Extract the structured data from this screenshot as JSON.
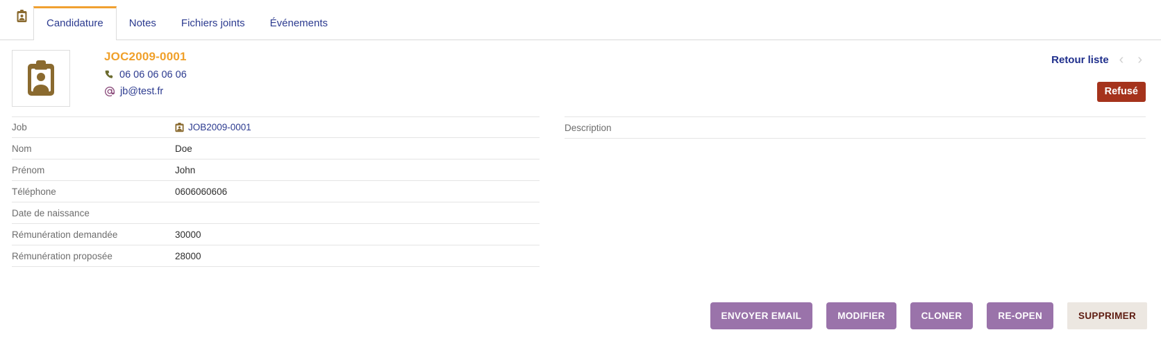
{
  "tabs": {
    "icon": "id-badge-icon",
    "items": [
      {
        "label": "Candidature",
        "active": true
      },
      {
        "label": "Notes",
        "active": false
      },
      {
        "label": "Fichiers joints",
        "active": false
      },
      {
        "label": "Événements",
        "active": false
      }
    ]
  },
  "header": {
    "avatar_icon": "id-badge-icon",
    "record_title": "JOC2009-0001",
    "phone": "06 06 06 06 06",
    "phone_icon": "phone-icon",
    "email": "jb@test.fr",
    "email_icon": "at-sign-icon",
    "back_label": "Retour liste",
    "prev_icon": "chevron-left-icon",
    "next_icon": "chevron-right-icon",
    "status": "Refusé",
    "status_color": "#a5331c",
    "title_color": "#f0a02a"
  },
  "fields": [
    {
      "label": "Job",
      "value": "JOB2009-0001",
      "is_link": true,
      "icon": "job-badge-icon"
    },
    {
      "label": "Nom",
      "value": "Doe",
      "is_link": false
    },
    {
      "label": "Prénom",
      "value": "John",
      "is_link": false
    },
    {
      "label": "Téléphone",
      "value": "0606060606",
      "is_link": false
    },
    {
      "label": "Date de naissance",
      "value": "",
      "is_link": false
    },
    {
      "label": "Rémunération demandée",
      "value": "30000",
      "is_link": false
    },
    {
      "label": "Rémunération proposée",
      "value": "28000",
      "is_link": false
    }
  ],
  "description": {
    "label": "Description",
    "value": ""
  },
  "actions": [
    {
      "label": "ENVOYER EMAIL",
      "style": "primary"
    },
    {
      "label": "MODIFIER",
      "style": "primary"
    },
    {
      "label": "CLONER",
      "style": "primary"
    },
    {
      "label": "RE-OPEN",
      "style": "primary"
    },
    {
      "label": "SUPPRIMER",
      "style": "danger"
    }
  ]
}
